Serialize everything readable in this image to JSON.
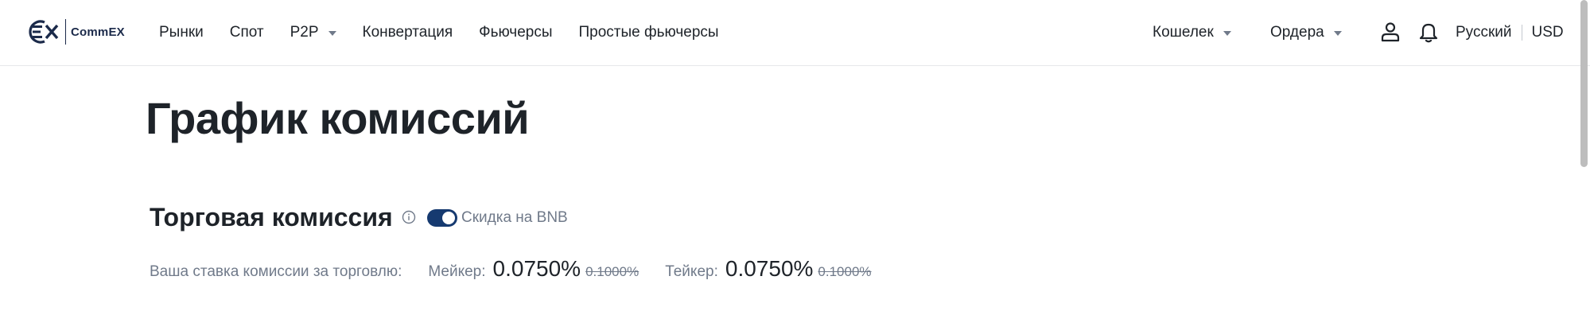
{
  "header": {
    "logo_text": "CommEX",
    "nav": [
      {
        "label": "Рынки"
      },
      {
        "label": "Спот"
      },
      {
        "label": "P2P"
      },
      {
        "label": "Конвертация"
      },
      {
        "label": "Фьючерсы"
      },
      {
        "label": "Простые фьючерсы"
      }
    ],
    "wallet_label": "Кошелек",
    "orders_label": "Ордера",
    "language": "Русский",
    "currency": "USD"
  },
  "main": {
    "page_title": "График комиссий",
    "section_title": "Торговая комиссия",
    "bnb_discount": {
      "label": "Скидка на BNB",
      "enabled": true
    },
    "rates": {
      "label": "Ваша ставка комиссии за торговлю:",
      "maker_label": "Мейкер:",
      "maker_value": "0.0750%",
      "maker_old": "0.1000%",
      "taker_label": "Тейкер:",
      "taker_value": "0.0750%",
      "taker_old": "0.1000%"
    }
  },
  "icons": {
    "user": "user-icon",
    "bell": "bell-icon",
    "info": "info-icon",
    "caret": "caret-down-icon"
  },
  "colors": {
    "brand": "#1b2a4a",
    "toggle_on": "#163a70",
    "text_primary": "#1e2329",
    "text_secondary": "#707a8a"
  }
}
